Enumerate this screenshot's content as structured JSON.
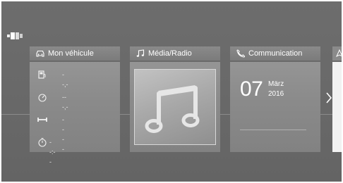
{
  "vehicle": {
    "title": "Mon véhicule",
    "rows": [
      {
        "icon": "fuel-icon",
        "value": "--,-"
      },
      {
        "icon": "gauge-icon",
        "value": "---,-"
      },
      {
        "icon": "range-icon",
        "value": "----"
      },
      {
        "icon": "timer-icon",
        "value": "--:--"
      }
    ]
  },
  "media": {
    "title": "Média/Radio",
    "art_icon": "music-note-icon"
  },
  "communication": {
    "title": "Communication",
    "day": "07",
    "month": "März",
    "year": "2016"
  },
  "nav": {
    "next_icon": "chevron-right-icon"
  },
  "colors": {
    "background": "#6b6b6b",
    "tile": "#8a8a8a",
    "header": "#7d7d7d"
  }
}
